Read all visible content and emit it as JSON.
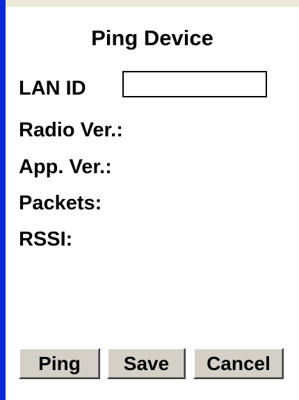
{
  "dialog": {
    "title": "Ping Device"
  },
  "fields": {
    "lan_id_label": "LAN ID",
    "lan_id_value": "",
    "radio_ver_label": "Radio Ver.:",
    "app_ver_label": "App. Ver.:",
    "packets_label": "Packets:",
    "rssi_label": "RSSI:"
  },
  "buttons": {
    "ping": "Ping",
    "save": "Save",
    "cancel": "Cancel"
  },
  "colors": {
    "accent_bar": "#0a2ad8",
    "top_strip": "#ece9d8",
    "button_face": "#d4d0c8",
    "background": "#ffffff"
  }
}
